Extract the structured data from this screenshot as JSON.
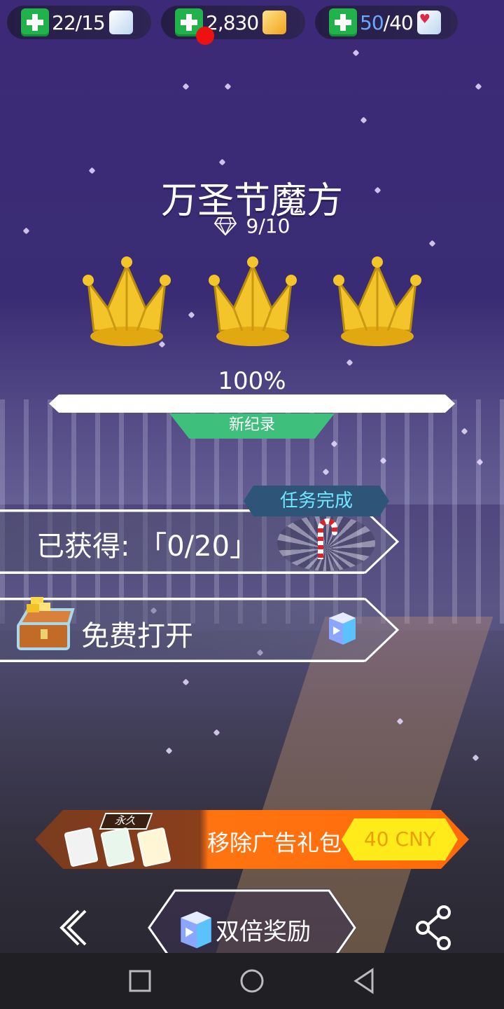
{
  "top_bar": {
    "cubes": {
      "value": "22/15"
    },
    "coins": {
      "value": "2,830"
    },
    "lives": {
      "current": "50",
      "max": "/40"
    }
  },
  "level": {
    "title": "万圣节魔方",
    "gems": "9/10",
    "crowns_earned": 3,
    "percent": "100%",
    "progress_fraction": 1.0,
    "record_label": "新纪录"
  },
  "task": {
    "badge": "任务完成",
    "obtained_label": "已获得: 「0/20」"
  },
  "chest": {
    "label": "免费打开"
  },
  "promo": {
    "permanent_tag": "永久",
    "label": "移除广告礼包",
    "price": "40 CNY"
  },
  "bottom": {
    "double_reward_label": "双倍奖励"
  },
  "colors": {
    "accent_green": "#3ebf7c",
    "promo_orange": "#ff6a0a",
    "price_yellow": "#ffea1a",
    "task_text": "#6fe7ff"
  },
  "icons": [
    "plus-icon",
    "cube-icon",
    "gold-cube-icon",
    "heart-cube-icon",
    "diamond-icon",
    "crown-icon",
    "candy-cane-icon",
    "chest-icon",
    "ad-cube-icon",
    "back-icon",
    "share-icon"
  ]
}
